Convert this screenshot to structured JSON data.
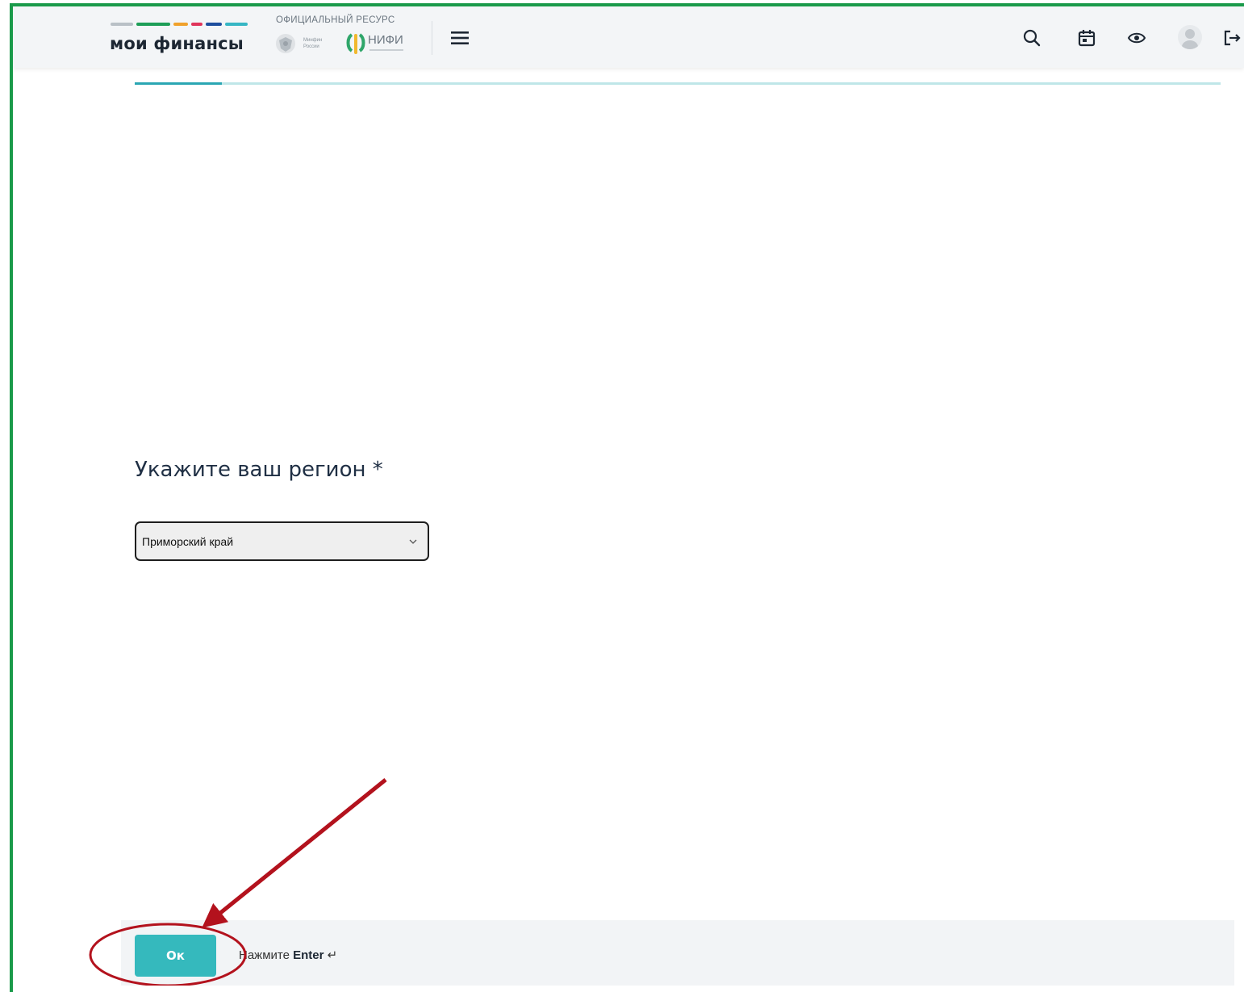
{
  "header": {
    "brand": "мои финансы",
    "official_label": "ОФИЦИАЛЬНЫЙ РЕСУРС",
    "minfin_label": "Минфин России",
    "nifi_label": "НИФИ",
    "stripe_colors": [
      "#b9c0c6",
      "#1e9e57",
      "#f0a12b",
      "#e0345a",
      "#1d4e9e",
      "#36b6c4"
    ],
    "icons": [
      "menu-icon",
      "search-icon",
      "calendar-icon",
      "eye-icon",
      "avatar",
      "logout-icon"
    ]
  },
  "progress": {
    "fraction": 0.08,
    "color": "#2aa6b3",
    "track_color": "#bfe6e8"
  },
  "question": {
    "title": "Укажите ваш регион *",
    "select_value": "Приморский край"
  },
  "footer": {
    "ok_label": "Ок",
    "hint_prefix": "Нажмите",
    "hint_key": "Enter",
    "hint_symbol": "↵",
    "accent": "#35b9bd"
  },
  "annotation": {
    "color": "#b3121d"
  }
}
